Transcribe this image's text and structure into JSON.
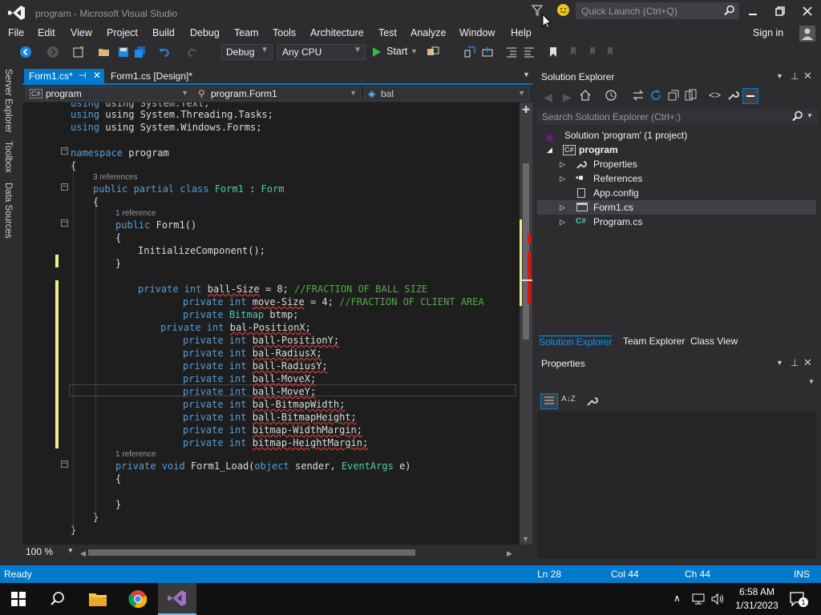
{
  "window": {
    "title": "program - Microsoft Visual Studio",
    "quick_launch_placeholder": "Quick Launch (Ctrl+Q)",
    "sign_in": "Sign in"
  },
  "menu": [
    "File",
    "Edit",
    "View",
    "Project",
    "Build",
    "Debug",
    "Team",
    "Tools",
    "Architecture",
    "Test",
    "Analyze",
    "Window",
    "Help"
  ],
  "toolbar": {
    "config": "Debug",
    "platform": "Any CPU",
    "start": "Start"
  },
  "side_tabs": [
    "Server Explorer",
    "Toolbox",
    "Data Sources"
  ],
  "document_tabs": [
    {
      "label": "Form1.cs*",
      "active": true
    },
    {
      "label": "Form1.cs [Design]*",
      "active": false
    }
  ],
  "nav": {
    "project": "program",
    "class": "program.Form1",
    "member": "bal"
  },
  "code": {
    "l1": "using System.Text;",
    "l2": "using System.Threading.Tasks;",
    "l3": "using System.Windows.Forms;",
    "namespace_kw": "namespace",
    "namespace_name": "program",
    "ref3": "3 references",
    "ref1": "1 reference",
    "class_kw": "public partial class",
    "class_name": "Form1",
    "class_base": "Form",
    "ctor": "Form1()",
    "init": "InitializeComponent();",
    "f1_name": "ball-Size",
    "f1_val": " = 8; ",
    "f1_comment": "//FRACTION OF BALL SIZE",
    "f2_name": "move-Size",
    "f2_val": " = 4; ",
    "f2_comment": "//FRACTION OF CLIENT AREA",
    "f3_type": "Bitmap",
    "f3_name": "btmp;",
    "f4": "bal-PositionX;",
    "f5": "ball-PositionY;",
    "f6": "bal-RadiusX;",
    "f7": "ball-RadiusY;",
    "f8": "ball-MoveX;",
    "f9": "ball-MoveY;",
    "f10": "bal-BitmapWidth;",
    "f11": "ball-BitmapHeight;",
    "f12": "bitmap-WidthMargin;",
    "f13": "bitmap-HeightMargin;",
    "load_kw": "private void",
    "load_name": "Form1_Load(",
    "load_p1": "object",
    "load_p2": " sender, ",
    "load_p3": "EventArgs",
    "load_p4": " e)",
    "private_int": "private int",
    "private": "private",
    "public": "public"
  },
  "zoom": "100 %",
  "solution_explorer": {
    "header": "Solution Explorer",
    "search_placeholder": "Search Solution Explorer (Ctrl+;)",
    "solution": "Solution 'program' (1 project)",
    "project": "program",
    "items": [
      "Properties",
      "References",
      "App.config",
      "Form1.cs",
      "Program.cs"
    ],
    "tabs": [
      "Solution Explorer",
      "Team Explorer",
      "Class View"
    ]
  },
  "properties": {
    "header": "Properties"
  },
  "status": {
    "ready": "Ready",
    "ln": "Ln 28",
    "col": "Col 44",
    "ch": "Ch 44",
    "mode": "INS"
  },
  "taskbar": {
    "time": "6:58 AM",
    "date": "1/31/2023",
    "notif_count": "1"
  },
  "colors": {
    "accent": "#007acc",
    "vs_purple": "#68217a",
    "keyword": "#569cd6",
    "type": "#4ec9b0",
    "comment": "#57a64a"
  }
}
